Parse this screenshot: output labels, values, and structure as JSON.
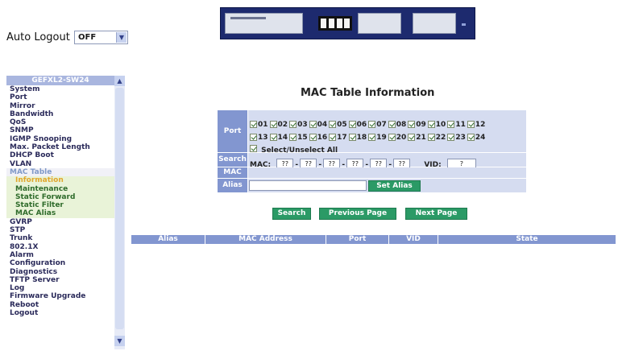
{
  "auto_logout": {
    "label": "Auto Logout",
    "value": "OFF"
  },
  "sidebar": {
    "title": "GEFXL2-SW24",
    "items": [
      {
        "label": "System",
        "kind": "item"
      },
      {
        "label": "Port",
        "kind": "item"
      },
      {
        "label": "Mirror",
        "kind": "item"
      },
      {
        "label": "Bandwidth",
        "kind": "item"
      },
      {
        "label": "QoS",
        "kind": "item"
      },
      {
        "label": "SNMP",
        "kind": "item"
      },
      {
        "label": "IGMP Snooping",
        "kind": "item"
      },
      {
        "label": "Max. Packet Length",
        "kind": "item"
      },
      {
        "label": "DHCP Boot",
        "kind": "item"
      },
      {
        "label": "VLAN",
        "kind": "item"
      },
      {
        "label": "MAC Table",
        "kind": "tree"
      },
      {
        "label": "Information",
        "kind": "sub-active"
      },
      {
        "label": "Maintenance",
        "kind": "sub"
      },
      {
        "label": "Static Forward",
        "kind": "sub"
      },
      {
        "label": "Static Filter",
        "kind": "sub"
      },
      {
        "label": "MAC Alias",
        "kind": "sub"
      },
      {
        "label": "GVRP",
        "kind": "item"
      },
      {
        "label": "STP",
        "kind": "item"
      },
      {
        "label": "Trunk",
        "kind": "item"
      },
      {
        "label": "802.1X",
        "kind": "item"
      },
      {
        "label": "Alarm",
        "kind": "item"
      },
      {
        "label": "Configuration",
        "kind": "item"
      },
      {
        "label": "Diagnostics",
        "kind": "item"
      },
      {
        "label": "TFTP Server",
        "kind": "item"
      },
      {
        "label": "Log",
        "kind": "item"
      },
      {
        "label": "Firmware Upgrade",
        "kind": "item"
      },
      {
        "label": "Reboot",
        "kind": "item"
      },
      {
        "label": "Logout",
        "kind": "item"
      }
    ]
  },
  "main": {
    "title": "MAC Table Information",
    "port_label": "Port",
    "ports_row1": [
      "01",
      "02",
      "03",
      "04",
      "05",
      "06",
      "07",
      "08",
      "09",
      "10",
      "11",
      "12"
    ],
    "ports_row2": [
      "13",
      "14",
      "15",
      "16",
      "17",
      "18",
      "19",
      "20",
      "21",
      "22",
      "23",
      "24"
    ],
    "select_all_label": "Select/Unselect All",
    "search_label": "Search",
    "mac_prefix": "MAC:",
    "mac_values": [
      "??",
      "??",
      "??",
      "??",
      "??",
      "??"
    ],
    "vid_label": "VID:",
    "vid_value": "?",
    "mac_label": "MAC",
    "alias_label": "Alias",
    "alias_value": "",
    "set_alias_button": "Set Alias",
    "search_button": "Search",
    "prev_button": "Previous Page",
    "next_button": "Next Page",
    "columns": [
      "Alias",
      "MAC Address",
      "Port",
      "VID",
      "State"
    ]
  },
  "colors": {
    "header_blue": "#8296d0",
    "form_bg": "#d5dcf0",
    "button_green": "#2b9a66"
  }
}
